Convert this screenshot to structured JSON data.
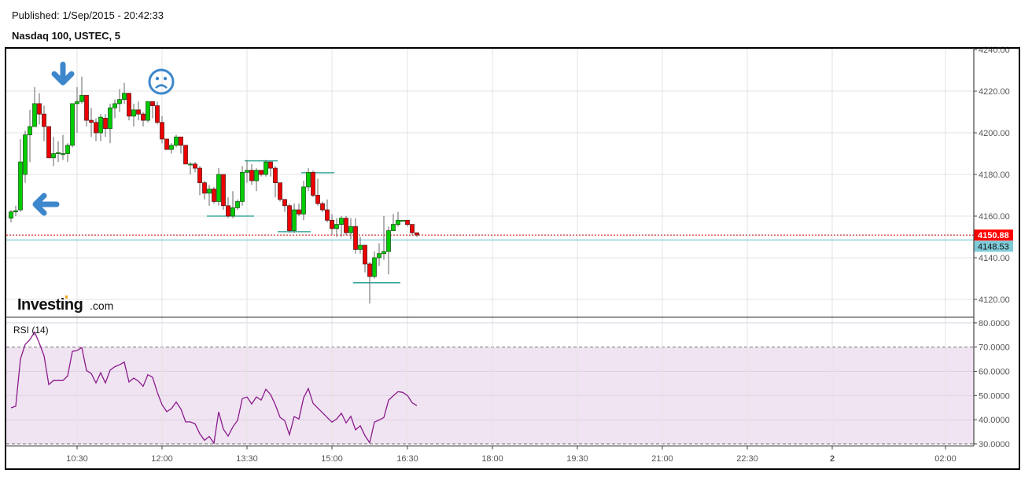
{
  "header": {
    "published": "Published: 1/Sep/2015 - 20:42:33",
    "symbol": "Nasdaq 100, USTEC, 5"
  },
  "logo": {
    "text": "Investing",
    "suffix": ".com"
  },
  "colors": {
    "up": "#00cc00",
    "down": "#ee0000",
    "rsi": "#8b1a8b",
    "rsi_band": "#f0e4f2",
    "support": "#1a9a8a",
    "last_price": "#ff0000",
    "ref_price": "#7ecbd8"
  },
  "chart_data": {
    "type": "candlestick",
    "title": "Nasdaq 100, USTEC, 5",
    "ylim": [
      4113,
      4242
    ],
    "y_ticks": [
      "4240.00",
      "4220.00",
      "4200.00",
      "4180.00",
      "4160.00",
      "4140.00",
      "4120.00"
    ],
    "y_tick_values": [
      4240,
      4220,
      4200,
      4180,
      4160,
      4140,
      4120
    ],
    "x_ticks": [
      "10:30",
      "12:00",
      "13:30",
      "15:00",
      "16:30",
      "18:00",
      "19:30",
      "21:00",
      "22:30",
      "2",
      "02:00"
    ],
    "last_price": {
      "value": 4150.88,
      "label": "4150.88"
    },
    "ref_price": {
      "value": 4148.53,
      "label": "4148.53"
    },
    "grid": true,
    "candles": [
      [
        4159,
        4163,
        4157,
        4162
      ],
      [
        4162,
        4165,
        4160,
        4162.6
      ],
      [
        4163,
        4197,
        4162,
        4186
      ],
      [
        4180,
        4201,
        4176,
        4199
      ],
      [
        4199,
        4211,
        4186,
        4203
      ],
      [
        4203,
        4222,
        4203,
        4214
      ],
      [
        4214,
        4219,
        4204,
        4209
      ],
      [
        4209,
        4213,
        4196,
        4203
      ],
      [
        4203,
        4203,
        4188,
        4188
      ],
      [
        4188,
        4198,
        4184,
        4190
      ],
      [
        4190,
        4196,
        4186,
        4190.5
      ],
      [
        4190,
        4199,
        4187,
        4190
      ],
      [
        4190,
        4195,
        4186,
        4194
      ],
      [
        4194,
        4214,
        4193,
        4214
      ],
      [
        4214,
        4222,
        4200,
        4215
      ],
      [
        4215,
        4227,
        4214,
        4218
      ],
      [
        4218,
        4218,
        4203,
        4206
      ],
      [
        4206,
        4212,
        4198,
        4205
      ],
      [
        4205,
        4207,
        4196,
        4200
      ],
      [
        4200,
        4209,
        4196,
        4207.5
      ],
      [
        4207,
        4209,
        4198,
        4202
      ],
      [
        4202,
        4214,
        4195,
        4212
      ],
      [
        4212,
        4216,
        4207,
        4214
      ],
      [
        4214,
        4221,
        4210,
        4216
      ],
      [
        4216,
        4224,
        4214,
        4219
      ],
      [
        4219,
        4219,
        4206,
        4208
      ],
      [
        4208,
        4214,
        4203,
        4211
      ],
      [
        4211,
        4215,
        4206,
        4209
      ],
      [
        4209,
        4210,
        4203,
        4206
      ],
      [
        4206,
        4215,
        4205,
        4215
      ],
      [
        4215,
        4215,
        4207,
        4213
      ],
      [
        4213,
        4215,
        4204,
        4205
      ],
      [
        4205,
        4208,
        4195,
        4197
      ],
      [
        4197,
        4197,
        4192,
        4192
      ],
      [
        4192,
        4195,
        4190,
        4194
      ],
      [
        4194,
        4199,
        4193,
        4198
      ],
      [
        4198,
        4198,
        4190,
        4194
      ],
      [
        4194,
        4194,
        4185,
        4185
      ],
      [
        4185,
        4186,
        4180,
        4185
      ],
      [
        4185,
        4186,
        4181,
        4183
      ],
      [
        4183,
        4184,
        4170,
        4176
      ],
      [
        4176,
        4177,
        4168,
        4171
      ],
      [
        4171,
        4175,
        4165,
        4173
      ],
      [
        4173,
        4174,
        4166,
        4167
      ],
      [
        4167,
        4183,
        4165,
        4180
      ],
      [
        4180,
        4180,
        4163,
        4165
      ],
      [
        4165,
        4169,
        4159,
        4160
      ],
      [
        4160,
        4172,
        4159,
        4164
      ],
      [
        4164,
        4168,
        4163,
        4167
      ],
      [
        4167,
        4184,
        4165,
        4181
      ],
      [
        4181,
        4187,
        4176,
        4182
      ],
      [
        4182,
        4185,
        4175,
        4177
      ],
      [
        4177,
        4183,
        4172,
        4182
      ],
      [
        4182,
        4181,
        4179,
        4180
      ],
      [
        4180,
        4187,
        4179,
        4186
      ],
      [
        4186,
        4186,
        4179,
        4183
      ],
      [
        4183,
        4184,
        4169,
        4176
      ],
      [
        4176,
        4173,
        4167,
        4168
      ],
      [
        4168,
        4168,
        4162,
        4165
      ],
      [
        4165,
        4166,
        4152,
        4153
      ],
      [
        4153,
        4166,
        4152,
        4163
      ],
      [
        4163,
        4166,
        4160,
        4161
      ],
      [
        4161,
        4177,
        4158,
        4174
      ],
      [
        4174,
        4183,
        4172,
        4181
      ],
      [
        4181,
        4182,
        4169,
        4170
      ],
      [
        4170,
        4178,
        4165,
        4166
      ],
      [
        4166,
        4167,
        4162,
        4163
      ],
      [
        4163,
        4168,
        4157,
        4158
      ],
      [
        4158,
        4161,
        4151,
        4154
      ],
      [
        4154,
        4159,
        4150,
        4156
      ],
      [
        4156,
        4160,
        4150,
        4159
      ],
      [
        4159,
        4160,
        4151,
        4152
      ],
      [
        4152,
        4159,
        4149,
        4155
      ],
      [
        4155,
        4159,
        4142,
        4144
      ],
      [
        4144,
        4150,
        4142,
        4146
      ],
      [
        4146,
        4146,
        4133,
        4137
      ],
      [
        4137,
        4138,
        4118,
        4131
      ],
      [
        4131,
        4143,
        4130,
        4140
      ],
      [
        4140,
        4147,
        4136,
        4142
      ],
      [
        4142,
        4160,
        4139,
        4143
      ],
      [
        4143,
        4155,
        4132,
        4153
      ],
      [
        4153,
        4161,
        4153,
        4156
      ],
      [
        4156,
        4162,
        4155,
        4158
      ],
      [
        4158,
        4158,
        4158,
        4158
      ],
      [
        4158,
        4158,
        4155,
        4156
      ],
      [
        4156,
        4156,
        4151,
        4152
      ],
      [
        4152,
        4152,
        4150,
        4150.88
      ]
    ],
    "support_lines": [
      {
        "price": 4160,
        "from": 42,
        "to": 51
      },
      {
        "price": 4186.5,
        "from": 50,
        "to": 56
      },
      {
        "price": 4152.5,
        "from": 57,
        "to": 63
      },
      {
        "price": 4180.8,
        "from": 62,
        "to": 68
      },
      {
        "price": 4128,
        "from": 73,
        "to": 82
      }
    ],
    "rsi": {
      "label": "RSI (14)",
      "ylim": [
        27,
        81
      ],
      "y_ticks": [
        "80.0000",
        "70.0000",
        "60.0000",
        "50.0000",
        "40.0000",
        "30.0000"
      ],
      "y_tick_values": [
        80,
        70,
        60,
        50,
        40,
        30
      ],
      "overbought": 70,
      "oversold": 30,
      "values": [
        44.9,
        45.6,
        65.1,
        71.1,
        73.1,
        76.2,
        71.6,
        66.4,
        54.5,
        56.2,
        56.2,
        56.2,
        58.1,
        68.2,
        68.6,
        69.8,
        60.3,
        59.1,
        55.2,
        59.4,
        55.2,
        60.5,
        61.9,
        62.7,
        63.8,
        55.6,
        57.2,
        55.9,
        53.8,
        58.6,
        57.5,
        51.3,
        46.2,
        43.3,
        44.6,
        47.3,
        44.4,
        39.1,
        39.1,
        38.3,
        34.2,
        31.5,
        33.1,
        30.3,
        43.2,
        36.1,
        33.2,
        37,
        39.7,
        48.7,
        49.4,
        46.5,
        49.4,
        48.1,
        52.6,
        50.4,
        46.2,
        41,
        39.6,
        33.8,
        41.3,
        40.3,
        49.1,
        52.9,
        46.8,
        44.8,
        42.9,
        40.9,
        39,
        40.3,
        42.7,
        38.7,
        41.4,
        35.8,
        37.5,
        33.4,
        30.5,
        39,
        39.9,
        40.9,
        48.1,
        49.9,
        51.6,
        51.3,
        50,
        47,
        45.8
      ]
    }
  }
}
